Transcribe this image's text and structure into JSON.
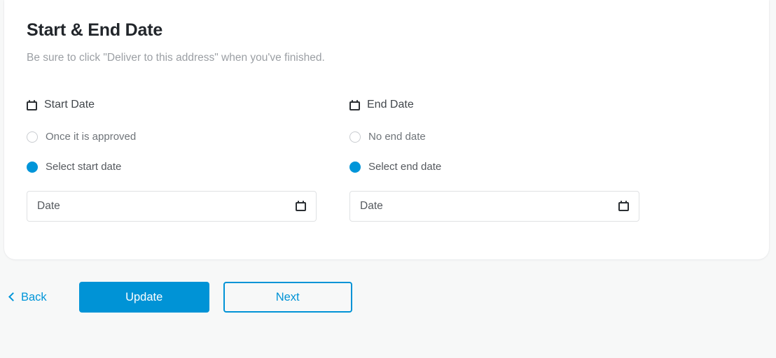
{
  "card": {
    "title": "Start & End Date",
    "subtitle": "Be sure to click \"Deliver to this address\" when you've finished."
  },
  "start_date": {
    "icon": "calendar-icon",
    "label": "Start Date",
    "options": [
      {
        "label": "Once it is approved",
        "selected": false
      },
      {
        "label": "Select start date",
        "selected": true
      }
    ],
    "input": {
      "placeholder": "Date",
      "value": "",
      "picker_icon": "calendar-picker-icon"
    }
  },
  "end_date": {
    "icon": "calendar-icon",
    "label": "End Date",
    "options": [
      {
        "label": "No end date",
        "selected": false
      },
      {
        "label": "Select end date",
        "selected": true
      }
    ],
    "input": {
      "placeholder": "Date",
      "value": "",
      "picker_icon": "calendar-picker-icon"
    }
  },
  "footer": {
    "back_label": "Back",
    "back_icon": "chevron-left-icon",
    "update_label": "Update",
    "next_label": "Next"
  },
  "colors": {
    "brand_blue": "#0095d9",
    "button_blue": "#0093d6",
    "page_background": "#f7f8f8",
    "card_background": "#ffffff",
    "title_text": "#22262b",
    "subtitle_text": "#9b9fa4",
    "label_text": "#41464b",
    "muted_text": "#6f7479",
    "input_border": "#dfe1e3"
  }
}
